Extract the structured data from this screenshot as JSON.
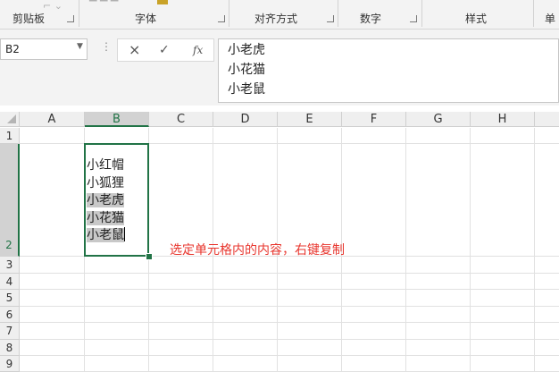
{
  "ribbon": {
    "groups": [
      "剪贴板",
      "字体",
      "对齐方式",
      "数字",
      "样式"
    ],
    "truncated_label": "单"
  },
  "name_box": {
    "value": "B2"
  },
  "formula_bar": {
    "cancel_icon": "×",
    "enter_icon": "✓",
    "fx_label": "fx",
    "lines": [
      "小老虎",
      "小花猫",
      "小老鼠"
    ]
  },
  "columns": [
    "A",
    "B",
    "C",
    "D",
    "E",
    "F",
    "G",
    "H"
  ],
  "rows": [
    "1",
    "2",
    "3",
    "4",
    "5",
    "6",
    "7",
    "8",
    "9"
  ],
  "selected_cell": "B2",
  "cell_b2_lines": [
    "小红帽",
    "小狐狸",
    "小老虎",
    "小花猫",
    "小老鼠"
  ],
  "annotation": "选定单元格内的内容，右键复制",
  "colors": {
    "selection": "#217346",
    "annotation": "#e8352d",
    "highlight": "#c8c8c8"
  }
}
